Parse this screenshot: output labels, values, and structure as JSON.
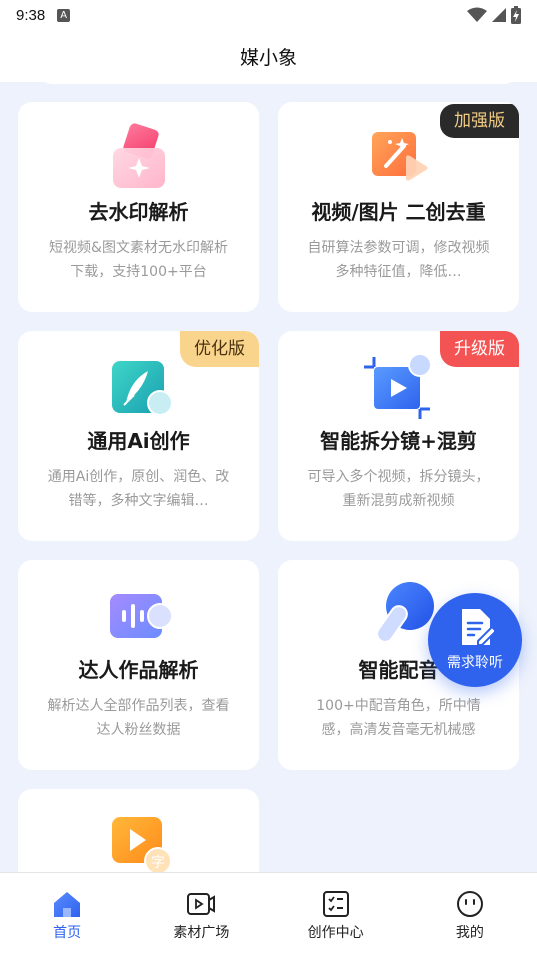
{
  "status_bar": {
    "time": "9:38",
    "notification_letter": "A"
  },
  "header": {
    "title": "媒小象"
  },
  "cards": [
    {
      "title": "去水印解析",
      "desc": "短视频&图文素材无水印解析下载，支持100+平台",
      "badge": "",
      "icon": "watermark-icon"
    },
    {
      "title": "视频/图片 二创去重",
      "desc": "自研算法参数可调，修改视频多种特征值，降低…",
      "badge": "加强版",
      "icon": "magic-video-icon"
    },
    {
      "title": "通用Ai创作",
      "desc": "通用Ai创作，原创、润色、改错等，多种文字编辑…",
      "badge": "优化版",
      "icon": "feather-pen-icon"
    },
    {
      "title": "智能拆分镜+混剪",
      "desc": "可导入多个视频，拆分镜头，重新混剪成新视频",
      "badge": "升级版",
      "icon": "crop-video-icon"
    },
    {
      "title": "达人作品解析",
      "desc": "解析达人全部作品列表，查看达人粉丝数据",
      "badge": "",
      "icon": "audio-wave-icon"
    },
    {
      "title": "智能配音",
      "desc": "100+中配音角色，所中情感，高清发音毫无机械感",
      "badge": "",
      "icon": "microphone-icon"
    },
    {
      "title": "",
      "desc": "",
      "badge": "",
      "icon": "video-subtitle-icon"
    }
  ],
  "fab": {
    "label": "需求聆听",
    "icon": "edit-document-icon"
  },
  "tabs": [
    {
      "label": "首页",
      "icon": "home-icon",
      "active": true
    },
    {
      "label": "素材广场",
      "icon": "video-library-icon",
      "active": false
    },
    {
      "label": "创作中心",
      "icon": "checklist-icon",
      "active": false
    },
    {
      "label": "我的",
      "icon": "profile-face-icon",
      "active": false
    }
  ],
  "colors": {
    "accent": "#2f63ee",
    "badge_red": "#f35353",
    "badge_gold": "#f9d48d",
    "badge_dark": "#2a2a2a"
  }
}
